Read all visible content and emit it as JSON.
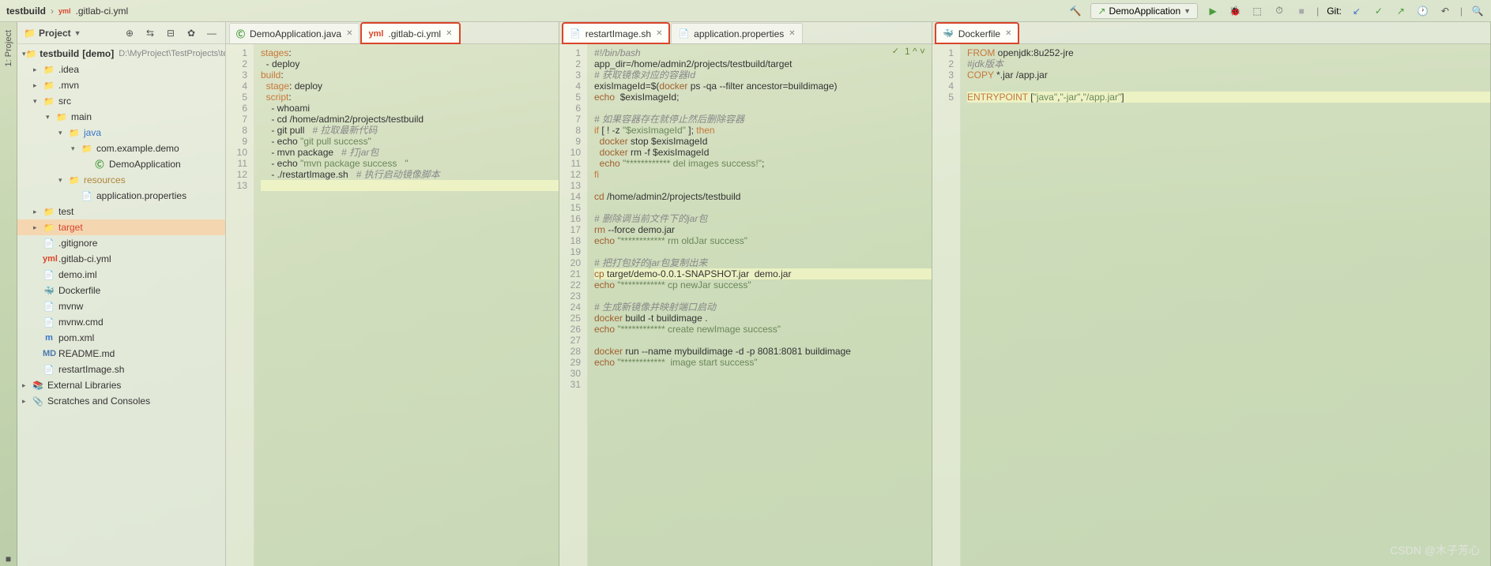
{
  "breadcrumb": {
    "project": "testbuild",
    "file": ".gitlab-ci.yml",
    "file_icon": "yml"
  },
  "toolbar": {
    "run_config": "DemoApplication",
    "git_label": "Git:",
    "icons": {
      "build": "▸",
      "run": "▶",
      "debug": "⌗",
      "bug": "🐞",
      "stop": "■",
      "branch": "↙",
      "update": "⟳",
      "commit": "✓",
      "push": "↗"
    }
  },
  "project_panel": {
    "title": "Project",
    "root": {
      "name": "testbuild",
      "module": "[demo]",
      "path": "D:\\MyProject\\TestProjects\\test"
    },
    "nodes": [
      {
        "indent": 1,
        "arrow": "▸",
        "icon": "📁",
        "name": ".idea"
      },
      {
        "indent": 1,
        "arrow": "▸",
        "icon": "📁",
        "name": ".mvn"
      },
      {
        "indent": 1,
        "arrow": "▾",
        "icon": "📁",
        "name": "src"
      },
      {
        "indent": 2,
        "arrow": "▾",
        "icon": "📁",
        "name": "main"
      },
      {
        "indent": 3,
        "arrow": "▾",
        "icon": "📁",
        "name": "java",
        "color": "#3874c9"
      },
      {
        "indent": 4,
        "arrow": "▾",
        "icon": "📁",
        "name": "com.example.demo"
      },
      {
        "indent": 5,
        "arrow": "",
        "icon": "Ⓒ",
        "name": "DemoApplication",
        "iconColor": "#4a9c3e"
      },
      {
        "indent": 3,
        "arrow": "▾",
        "icon": "📁",
        "name": "resources",
        "color": "#b0863a"
      },
      {
        "indent": 4,
        "arrow": "",
        "icon": "📄",
        "name": "application.properties"
      },
      {
        "indent": 1,
        "arrow": "▸",
        "icon": "📁",
        "name": "test"
      },
      {
        "indent": 1,
        "arrow": "▸",
        "icon": "📁",
        "name": "target",
        "selected": true,
        "color": "#d9452b"
      },
      {
        "indent": 1,
        "arrow": "",
        "icon": "📄",
        "name": ".gitignore"
      },
      {
        "indent": 1,
        "arrow": "",
        "icon": "yml",
        "name": ".gitlab-ci.yml",
        "iconColor": "#d9452b"
      },
      {
        "indent": 1,
        "arrow": "",
        "icon": "📄",
        "name": "demo.iml"
      },
      {
        "indent": 1,
        "arrow": "",
        "icon": "🐳",
        "name": "Dockerfile",
        "iconColor": "#2a7caa"
      },
      {
        "indent": 1,
        "arrow": "",
        "icon": "📄",
        "name": "mvnw"
      },
      {
        "indent": 1,
        "arrow": "",
        "icon": "📄",
        "name": "mvnw.cmd"
      },
      {
        "indent": 1,
        "arrow": "",
        "icon": "m",
        "name": "pom.xml",
        "iconColor": "#3874c9"
      },
      {
        "indent": 1,
        "arrow": "",
        "icon": "MD",
        "name": "README.md",
        "iconColor": "#4a7ab0"
      },
      {
        "indent": 1,
        "arrow": "",
        "icon": "📄",
        "name": "restartImage.sh"
      }
    ],
    "extra": [
      {
        "indent": 0,
        "arrow": "▸",
        "icon": "📚",
        "name": "External Libraries"
      },
      {
        "indent": 0,
        "arrow": "▸",
        "icon": "📎",
        "name": "Scratches and Consoles"
      }
    ]
  },
  "editors": {
    "pane1": {
      "tabs": [
        {
          "icon": "Ⓒ",
          "label": "DemoApplication.java",
          "iconColor": "#4a9c3e"
        },
        {
          "icon": "yml",
          "label": ".gitlab-ci.yml",
          "active": true,
          "highlight": true,
          "iconColor": "#d9452b"
        }
      ],
      "lines": [
        {
          "n": 1,
          "html": "<span class='kw'>stages</span>:"
        },
        {
          "n": 2,
          "html": "  - deploy"
        },
        {
          "n": 3,
          "html": "<span class='kw'>build</span>:"
        },
        {
          "n": 4,
          "html": "  <span class='kw'>stage</span>: deploy"
        },
        {
          "n": 5,
          "html": "  <span class='kw'>script</span>:"
        },
        {
          "n": 6,
          "html": "    - whoami"
        },
        {
          "n": 7,
          "html": "    - cd /home/admin2/projects/testbuild"
        },
        {
          "n": 8,
          "html": "    - git pull   <span class='cm'># 拉取最新代码</span>"
        },
        {
          "n": 9,
          "html": "    - echo <span class='str'>\"git pull success\"</span>"
        },
        {
          "n": 10,
          "html": "    - mvn package   <span class='cm'># 打jar包</span>"
        },
        {
          "n": 11,
          "html": "    - echo <span class='str'>\"mvn package success   \"</span>"
        },
        {
          "n": 12,
          "html": "    - ./restartImage.sh   <span class='cm'># 执行启动镜像脚本</span>"
        },
        {
          "n": 13,
          "html": "",
          "hl": true
        }
      ]
    },
    "pane2": {
      "tabs": [
        {
          "icon": "📄",
          "label": "restartImage.sh",
          "active": true,
          "highlight": true
        },
        {
          "icon": "📄",
          "label": "application.properties"
        }
      ],
      "hint": "1 ^ ˅",
      "lines": [
        {
          "n": 1,
          "html": "<span class='cm'>#!/bin/bash</span>"
        },
        {
          "n": 2,
          "html": "app_dir=/home/admin2/projects/testbuild/target"
        },
        {
          "n": 3,
          "html": "<span class='cm'># 获取镜像对应的容器Id</span>"
        },
        {
          "n": 4,
          "html": "exisImageId=$(<span class='cmd'>docker</span> ps -qa --filter ancestor=buildimage)"
        },
        {
          "n": 5,
          "html": "<span class='cmd'>echo</span>  $exisImageId;"
        },
        {
          "n": 6,
          "html": ""
        },
        {
          "n": 7,
          "html": "<span class='cm'># 如果容器存在就停止然后删除容器</span>"
        },
        {
          "n": 8,
          "html": "<span class='kw'>if</span> [ ! -z <span class='str'>\"$exisImageId\"</span> ]; <span class='kw'>then</span>"
        },
        {
          "n": 9,
          "html": "  <span class='cmd'>docker</span> stop $exisImageId"
        },
        {
          "n": 10,
          "html": "  <span class='cmd'>docker</span> rm -f $exisImageId"
        },
        {
          "n": 11,
          "html": "  <span class='cmd'>echo</span> <span class='str'>\"************ del images success!\"</span>;"
        },
        {
          "n": 12,
          "html": "<span class='kw'>fi</span>"
        },
        {
          "n": 13,
          "html": ""
        },
        {
          "n": 14,
          "html": "<span class='cmd'>cd</span> /home/admin2/projects/testbuild"
        },
        {
          "n": 15,
          "html": ""
        },
        {
          "n": 16,
          "html": "<span class='cm'># 删除调当前文件下的jar包</span>"
        },
        {
          "n": 17,
          "html": "<span class='cmd'>rm</span> --force demo.jar"
        },
        {
          "n": 18,
          "html": "<span class='cmd'>echo</span> <span class='str'>\"************ rm oldJar success\"</span>"
        },
        {
          "n": 19,
          "html": ""
        },
        {
          "n": 20,
          "html": "<span class='cm'># 把打包好的jar包复制出来</span>"
        },
        {
          "n": 21,
          "html": "<span class='cmd'>cp</span> target/demo-0.0.1-SNAPSHOT.jar  demo.jar",
          "hl": true
        },
        {
          "n": 22,
          "html": "<span class='cmd'>echo</span> <span class='str'>\"************ cp newJar success\"</span>"
        },
        {
          "n": 23,
          "html": ""
        },
        {
          "n": 24,
          "html": "<span class='cm'># 生成新镜像并映射端口启动</span>"
        },
        {
          "n": 25,
          "html": "<span class='cmd'>docker</span> build -t buildimage ."
        },
        {
          "n": 26,
          "html": "<span class='cmd'>echo</span> <span class='str'>\"************ create newImage success\"</span>"
        },
        {
          "n": 27,
          "html": ""
        },
        {
          "n": 28,
          "html": "<span class='cmd'>docker</span> run --name mybuildimage -d -p 8081:8081 buildimage"
        },
        {
          "n": 29,
          "html": "<span class='cmd'>echo</span> <span class='str'>\"************  image start success\"</span>"
        },
        {
          "n": 30,
          "html": ""
        },
        {
          "n": 31,
          "html": ""
        }
      ]
    },
    "pane3": {
      "tabs": [
        {
          "icon": "🐳",
          "label": "Dockerfile",
          "active": true,
          "highlight": true,
          "iconColor": "#2a7caa"
        }
      ],
      "lines": [
        {
          "n": 1,
          "html": "<span class='kw'>FROM</span> openjdk:8u252-jre"
        },
        {
          "n": 2,
          "html": "<span class='cm'>#jdk版本</span>"
        },
        {
          "n": 3,
          "html": "<span class='kw'>COPY</span> *.jar /app.jar"
        },
        {
          "n": 4,
          "html": ""
        },
        {
          "n": 5,
          "html": "<span class='kw'>ENTRYPOINT</span> [<span class='str'>\"java\"</span>,<span class='str'>\"-jar\"</span>,<span class='str'>\"/app.jar\"</span>]",
          "hl": true
        }
      ]
    }
  },
  "watermark": "CSDN @木子芳心"
}
